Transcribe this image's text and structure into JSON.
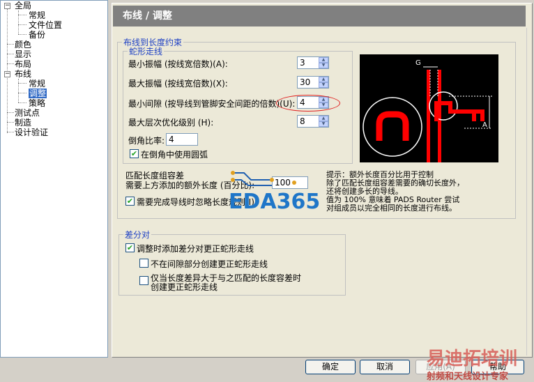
{
  "tree": [
    {
      "label": "全局"
    },
    {
      "label": "常规"
    },
    {
      "label": "文件位置"
    },
    {
      "label": "备份"
    },
    {
      "label": "颜色"
    },
    {
      "label": "显示"
    },
    {
      "label": "布局"
    },
    {
      "label": "布线"
    },
    {
      "label": "常规"
    },
    {
      "label": "调整"
    },
    {
      "label": "策略"
    },
    {
      "label": "测试点"
    },
    {
      "label": "制造"
    },
    {
      "label": "设计验证"
    }
  ],
  "header": {
    "title": "布线 / 调整"
  },
  "group_length": {
    "legend": "布线到长度约束"
  },
  "group_serp": {
    "legend": "蛇形走线"
  },
  "fields": {
    "min_amp": {
      "label": "最小振幅 (按线宽倍数)(A):",
      "value": "3"
    },
    "max_amp": {
      "label": "最大振幅 (按线宽倍数)(X):",
      "value": "30"
    },
    "min_gap": {
      "label": "最小间隙 (按导线到管脚安全间距的倍数)(U):",
      "value": "4"
    },
    "max_level": {
      "label": "最大层次优化级别 (H):",
      "value": "8"
    },
    "chamfer": {
      "label": "倒角比率:",
      "value": "4"
    },
    "arc_check": {
      "label": "在倒角中使用圆弧"
    }
  },
  "match": {
    "title": "匹配长度组容差",
    "extra_label": "需要上方添加的额外长度 (百分比):",
    "extra_value": "100",
    "ignore_label": "需要完成导线时忽略长度规则(I)"
  },
  "tip": {
    "line1": "提示：额外长度百分比用于控制",
    "line2": "除了匹配长度组容差需要的确切长度外，",
    "line3": "还将创建多长的导线。",
    "line4": "值为 100% 意味着 PADS Router 尝试",
    "line5": "对组成员以完全相同的长度进行布线。"
  },
  "diff": {
    "legend": "差分对",
    "opt1": "调整时添加差分对更正蛇形走线",
    "opt2": "不在间隙部分创建更正蛇形走线",
    "opt3a": "仅当长度差异大于与之匹配的长度容差时",
    "opt3b": "创建更正蛇形走线"
  },
  "diagram": {
    "g": "G",
    "a": "A"
  },
  "buttons": {
    "ok": "确定",
    "cancel": "取消",
    "apply": "应用(A)",
    "help": "帮助"
  },
  "watermark": {
    "eda": "EDA365",
    "brand": "易迪拓培训",
    "sub": "射频和天线设计专家"
  }
}
